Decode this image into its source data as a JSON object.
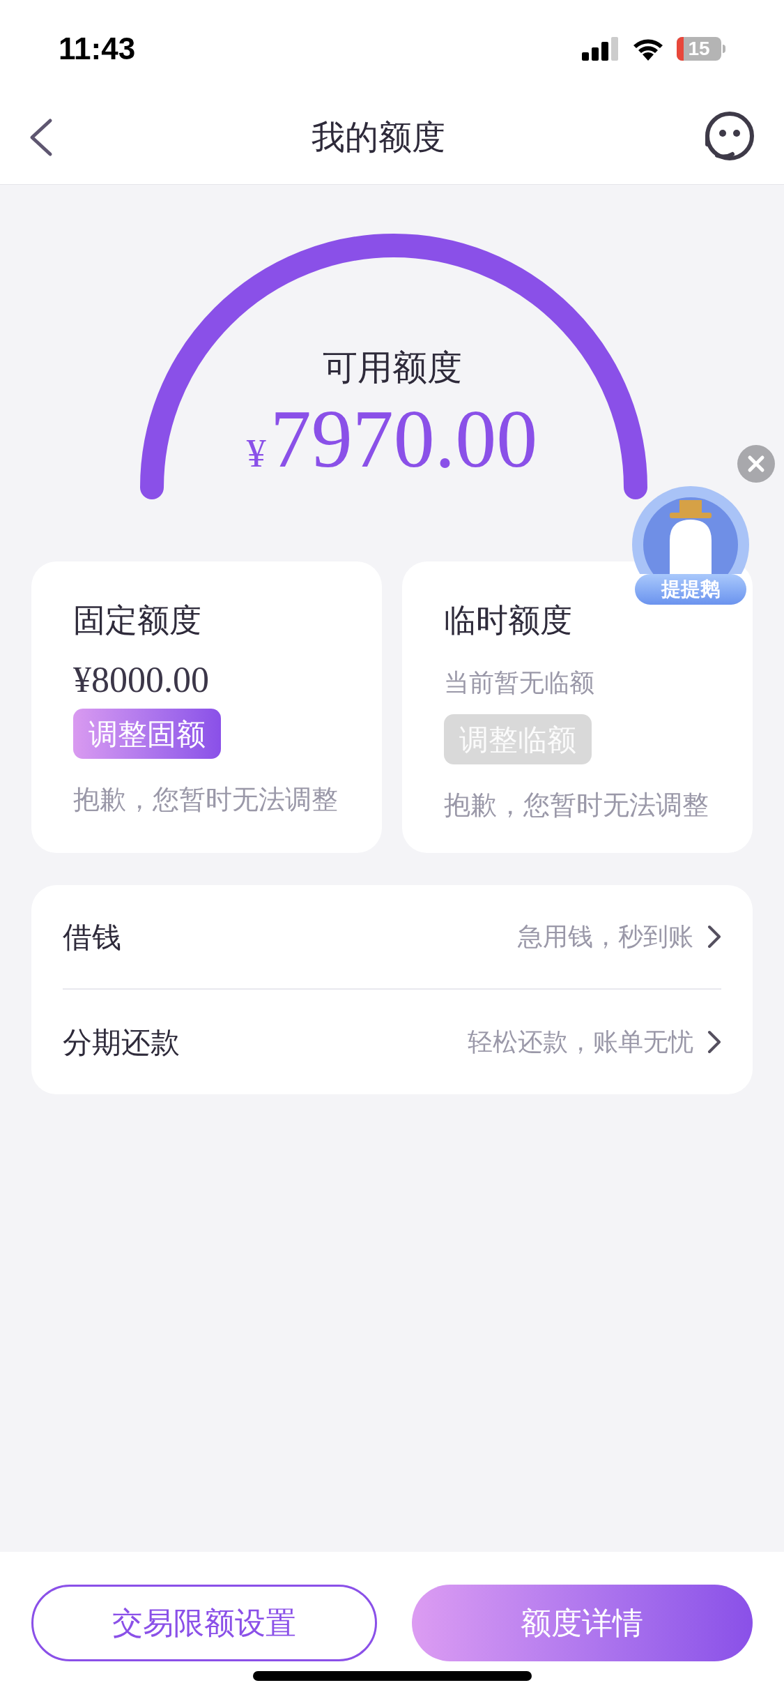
{
  "status_bar": {
    "time": "11:43",
    "battery": "15"
  },
  "nav": {
    "title": "我的额度"
  },
  "gauge": {
    "label": "可用额度",
    "currency": "¥",
    "amount": "7970.00"
  },
  "floating_badge": {
    "label": "提提鹅"
  },
  "cards": [
    {
      "kind": "fixed",
      "title": "固定额度",
      "value": "¥8000.00",
      "button": {
        "label": "调整固额",
        "disabled": false
      },
      "note": "抱歉，您暂时无法调整"
    },
    {
      "kind": "temporary",
      "title": "临时额度",
      "value": "当前暂无临额",
      "button": {
        "label": "调整临额",
        "disabled": true
      },
      "note": "抱歉，您暂时无法调整"
    }
  ],
  "menu": [
    {
      "label": "借钱",
      "hint": "急用钱，秒到账"
    },
    {
      "label": "分期还款",
      "hint": "轻松还款，账单无忧"
    }
  ],
  "bottom_buttons": [
    {
      "label": "交易限额设置",
      "kind": "outline"
    },
    {
      "label": "额度详情",
      "kind": "filled"
    }
  ]
}
